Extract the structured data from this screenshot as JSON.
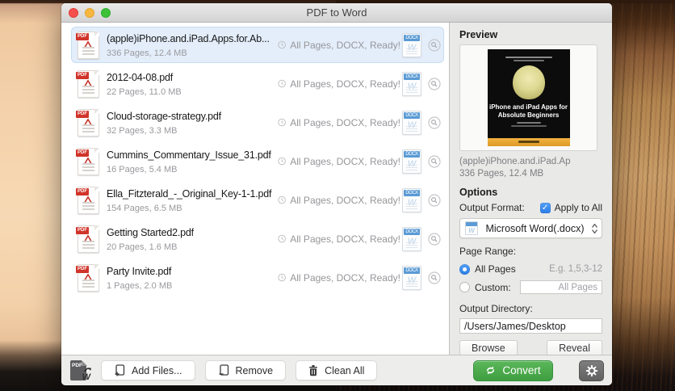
{
  "window": {
    "title": "PDF to Word"
  },
  "list": {
    "status_text": "All Pages, DOCX, Ready!",
    "files": [
      {
        "name": "(apple)iPhone.and.iPad.Apps.for.Ab...",
        "info": "336 Pages, 12.4 MB",
        "selected": true
      },
      {
        "name": "2012-04-08.pdf",
        "info": "22 Pages, 11.0 MB",
        "selected": false
      },
      {
        "name": "Cloud-storage-strategy.pdf",
        "info": "32 Pages, 3.3 MB",
        "selected": false
      },
      {
        "name": "Cummins_Commentary_Issue_31.pdf",
        "info": "16 Pages, 5.4 MB",
        "selected": false
      },
      {
        "name": "Ella_Fitzterald_-_Original_Key-1-1.pdf",
        "info": "154 Pages, 6.5 MB",
        "selected": false
      },
      {
        "name": "Getting Started2.pdf",
        "info": "20 Pages, 1.6 MB",
        "selected": false
      },
      {
        "name": "Party Invite.pdf",
        "info": "1 Pages, 2.0 MB",
        "selected": false
      }
    ]
  },
  "icons": {
    "pdf_badge": "PDF",
    "docx_badge": "DOCX",
    "docx_watermark": "W",
    "word_mini": "W",
    "applogo_top": "PDF",
    "applogo_bottom": "W"
  },
  "preview": {
    "heading": "Preview",
    "book_title_line1": "iPhone and iPad Apps for",
    "book_title_line2": "Absolute Beginners",
    "file_name": "(apple)iPhone.and.iPad.Ap",
    "file_info": "336 Pages, 12.4 MB"
  },
  "options": {
    "heading": "Options",
    "output_format_label": "Output Format:",
    "apply_to_all_label": "Apply to All",
    "checkbox_glyph": "✓",
    "format_value": "Microsoft Word(.docx)",
    "page_range_label": "Page Range:",
    "all_pages_label": "All Pages",
    "range_example": "E.g. 1,5,3-12",
    "custom_label": "Custom:",
    "custom_placeholder": "All Pages",
    "output_directory_label": "Output Directory:",
    "output_directory_value": "/Users/James/Desktop",
    "browse_label": "Browse",
    "reveal_label": "Reveal"
  },
  "toolbar": {
    "add_files_label": "Add Files...",
    "remove_label": "Remove",
    "clean_all_label": "Clean All",
    "convert_label": "Convert"
  },
  "colors": {
    "accent_blue": "#2f7cf6",
    "selected_row_bg": "#e4eefa",
    "convert_green": "#46a74c",
    "pdf_red": "#d0342a",
    "docx_blue": "#5b9bd5",
    "panel_gray": "#e9e9e7"
  }
}
